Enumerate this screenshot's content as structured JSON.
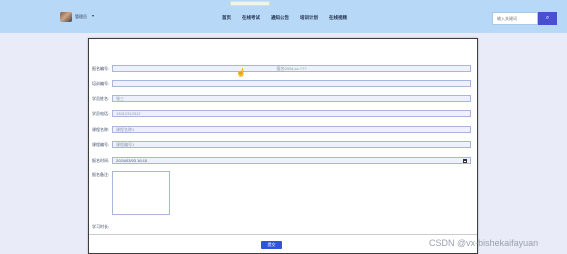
{
  "header": {
    "username": "管理员",
    "user_caret": "▾",
    "nav": [
      "首页",
      "在线考试",
      "通知公告",
      "培训计划",
      "在线视频"
    ],
    "search": {
      "placeholder": "输入关键词",
      "button_icon": "⌕"
    }
  },
  "form": {
    "rows": [
      {
        "label": "报名编号:",
        "value": "报名2024-xx-???",
        "kind": "text-center"
      },
      {
        "label": "培训编号:",
        "value": "",
        "kind": "text"
      },
      {
        "label": "学员姓名:",
        "value": "张三",
        "kind": "text"
      },
      {
        "label": "学员电话:",
        "value": "13312312312",
        "kind": "text"
      },
      {
        "label": "课程名称:",
        "value": "课程名称1",
        "kind": "text"
      },
      {
        "label": "课程编号:",
        "value": "课程编号1",
        "kind": "text"
      },
      {
        "label": "报名时间:",
        "value": "2024/03/03 16:15",
        "kind": "datetime"
      },
      {
        "label": "报名备注:",
        "value": "",
        "kind": "textarea"
      }
    ],
    "bottom_label": "学习时长:",
    "submit_label": "提交"
  },
  "watermark": "CSDN @vx-bishekaifayuan",
  "colors": {
    "header_bg": "#b7d9f7",
    "page_bg": "#e9ecf8",
    "accent": "#4a4fd1",
    "submit": "#2f54d6"
  }
}
